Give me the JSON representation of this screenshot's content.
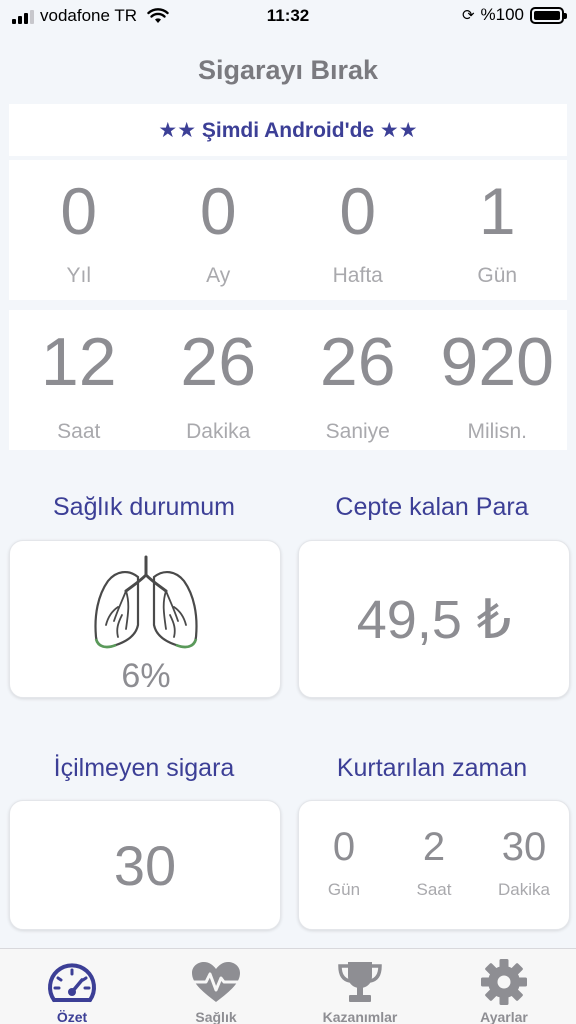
{
  "status_bar": {
    "carrier": "vodafone TR",
    "time": "11:32",
    "battery": "%100"
  },
  "header": {
    "title": "Sigarayı Bırak"
  },
  "promo": {
    "text": "★★ Şimdi Android'de ★★"
  },
  "elapsed": {
    "years": {
      "value": "0",
      "label": "Yıl"
    },
    "months": {
      "value": "0",
      "label": "Ay"
    },
    "weeks": {
      "value": "0",
      "label": "Hafta"
    },
    "days": {
      "value": "1",
      "label": "Gün"
    },
    "hours": {
      "value": "12",
      "label": "Saat"
    },
    "minutes": {
      "value": "26",
      "label": "Dakika"
    },
    "seconds": {
      "value": "26",
      "label": "Saniye"
    },
    "millis": {
      "value": "920",
      "label": "Milisn."
    }
  },
  "health": {
    "title": "Sağlık durumum",
    "percent": "6%",
    "progress": 0.06
  },
  "money": {
    "title": "Cepte kalan Para",
    "value": "49,5 ₺"
  },
  "cigarettes": {
    "title": "İçilmeyen sigara",
    "value": "30"
  },
  "saved_time": {
    "title": "Kurtarılan zaman",
    "days": {
      "value": "0",
      "label": "Gün"
    },
    "hours": {
      "value": "2",
      "label": "Saat"
    },
    "minutes": {
      "value": "30",
      "label": "Dakika"
    }
  },
  "tabs": [
    {
      "label": "Özet",
      "icon": "speedometer-icon",
      "active": true
    },
    {
      "label": "Sağlık",
      "icon": "heartbeat-icon",
      "active": false
    },
    {
      "label": "Kazanımlar",
      "icon": "trophy-icon",
      "active": false
    },
    {
      "label": "Ayarlar",
      "icon": "gear-icon",
      "active": false
    }
  ],
  "colors": {
    "accent": "#3c3f96",
    "text": "#8d8d92",
    "background": "#f3f6fa"
  }
}
